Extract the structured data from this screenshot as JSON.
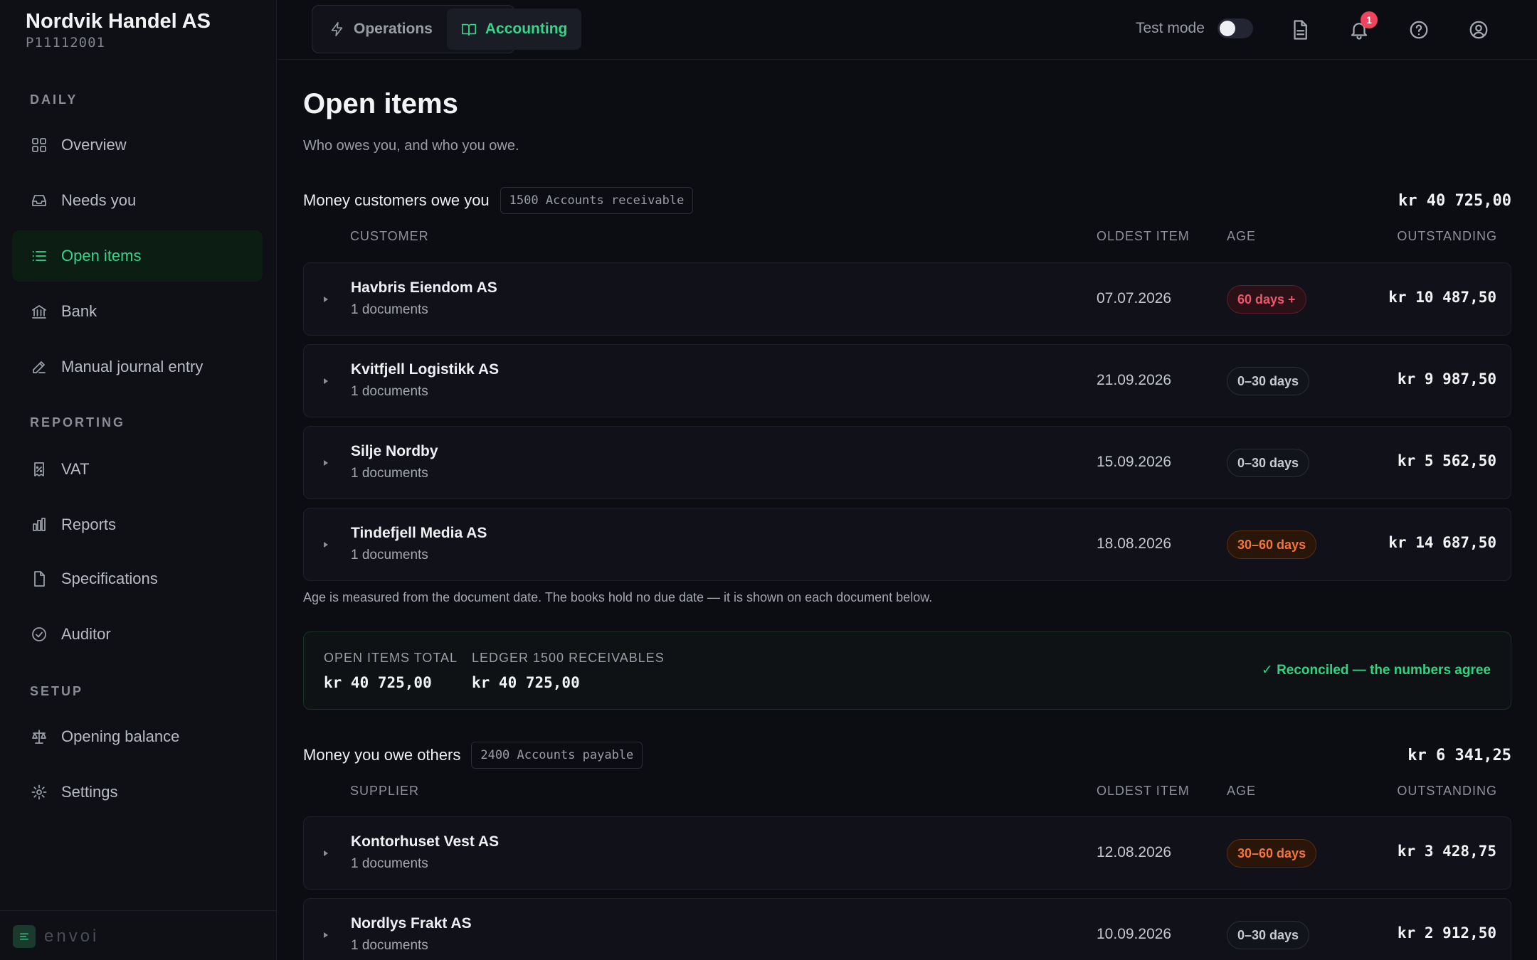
{
  "org": {
    "name": "Nordvik Handel AS",
    "id": "P11112001"
  },
  "sidebar": {
    "sections": [
      {
        "title": "DAILY",
        "items": [
          {
            "label": "Overview",
            "icon": "grid-icon"
          },
          {
            "label": "Needs you",
            "icon": "inbox-icon"
          },
          {
            "label": "Open items",
            "icon": "list-icon",
            "active": true
          },
          {
            "label": "Bank",
            "icon": "bank-icon"
          },
          {
            "label": "Manual journal entry",
            "icon": "edit-icon"
          }
        ]
      },
      {
        "title": "REPORTING",
        "items": [
          {
            "label": "VAT",
            "icon": "receipt-percent-icon"
          },
          {
            "label": "Reports",
            "icon": "bar-chart-icon"
          },
          {
            "label": "Specifications",
            "icon": "file-icon"
          },
          {
            "label": "Auditor",
            "icon": "check-circle-icon"
          }
        ]
      },
      {
        "title": "SETUP",
        "items": [
          {
            "label": "Opening balance",
            "icon": "scale-icon"
          },
          {
            "label": "Settings",
            "icon": "gear-icon"
          }
        ]
      }
    ],
    "brand": "envoi"
  },
  "header": {
    "tabs": [
      {
        "label": "Operations",
        "icon": "bolt-icon"
      },
      {
        "label": "Accounting",
        "icon": "book-open-icon",
        "active": true
      }
    ],
    "test_mode_label": "Test mode",
    "test_mode_on": false,
    "notification_count": "1",
    "accent_color": "#34d689"
  },
  "page": {
    "title": "Open items",
    "subtitle": "Who owes you, and who you owe."
  },
  "receivables": {
    "title": "Money customers owe you",
    "account": "1500 Accounts receivable",
    "total": "kr 40 725,00",
    "columns": {
      "party": "CUSTOMER",
      "oldest": "OLDEST ITEM",
      "age": "AGE",
      "outstanding": "OUTSTANDING"
    },
    "rows": [
      {
        "name": "Havbris Eiendom AS",
        "docs": "1 documents",
        "date": "07.07.2026",
        "age": "60 days +",
        "age_level": "red",
        "amount": "kr 10 487,50"
      },
      {
        "name": "Kvitfjell Logistikk AS",
        "docs": "1 documents",
        "date": "21.09.2026",
        "age": "0–30 days",
        "age_level": "green",
        "amount": "kr 9 987,50"
      },
      {
        "name": "Silje Nordby",
        "docs": "1 documents",
        "date": "15.09.2026",
        "age": "0–30 days",
        "age_level": "green",
        "amount": "kr 5 562,50"
      },
      {
        "name": "Tindefjell Media AS",
        "docs": "1 documents",
        "date": "18.08.2026",
        "age": "30–60 days",
        "age_level": "orange",
        "amount": "kr 14 687,50"
      }
    ],
    "note": "Age is measured from the document date. The books hold no due date — it is shown on each document below.",
    "reconciliation": {
      "open_label": "OPEN ITEMS TOTAL",
      "open_value": "kr 40 725,00",
      "ledger_label": "LEDGER 1500 RECEIVABLES",
      "ledger_value": "kr 40 725,00",
      "status": "✓ Reconciled — the numbers agree"
    }
  },
  "payables": {
    "title": "Money you owe others",
    "account": "2400 Accounts payable",
    "total": "kr 6 341,25",
    "columns": {
      "party": "SUPPLIER",
      "oldest": "OLDEST ITEM",
      "age": "AGE",
      "outstanding": "OUTSTANDING"
    },
    "rows": [
      {
        "name": "Kontorhuset Vest AS",
        "docs": "1 documents",
        "date": "12.08.2026",
        "age": "30–60 days",
        "age_level": "orange",
        "amount": "kr 3 428,75"
      },
      {
        "name": "Nordlys Frakt AS",
        "docs": "1 documents",
        "date": "10.09.2026",
        "age": "0–30 days",
        "age_level": "green",
        "amount": "kr 2 912,50"
      }
    ]
  }
}
